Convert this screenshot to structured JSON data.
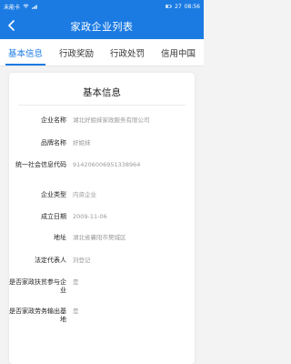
{
  "status_bar": {
    "carrier": "未能卡",
    "battery": "27",
    "time": "08:56"
  },
  "header": {
    "title": "家政企业列表"
  },
  "tabs": [
    {
      "label": "基本信息"
    },
    {
      "label": "行政奖励"
    },
    {
      "label": "行政处罚"
    },
    {
      "label": "信用中国"
    }
  ],
  "card": {
    "title": "基本信息",
    "fields": [
      {
        "label": "企业名称",
        "value": "湖北好姐妹家政服务有限公司"
      },
      {
        "label": "品牌名称",
        "value": "好姐妹"
      },
      {
        "label": "统一社会信息代码",
        "value": "914206006951338964"
      },
      {
        "label": "企业类型",
        "value": "内资企业"
      },
      {
        "label": "成立日期",
        "value": "2009-11-06"
      },
      {
        "label": "地址",
        "value": "湖北省襄阳市樊城区"
      },
      {
        "label": "法定代表人",
        "value": "刘登记"
      },
      {
        "label": "是否家政扶贫参与企业",
        "value": "是"
      },
      {
        "label": "是否家政劳务输出基地",
        "value": "是"
      }
    ]
  },
  "colors": {
    "primary": "#1b7be3",
    "background": "#f3f3f3",
    "value_text": "#9a9a9a"
  },
  "icons": [
    "back-arrow-icon",
    "wifi-icon",
    "signal-icon",
    "battery-icon"
  ]
}
